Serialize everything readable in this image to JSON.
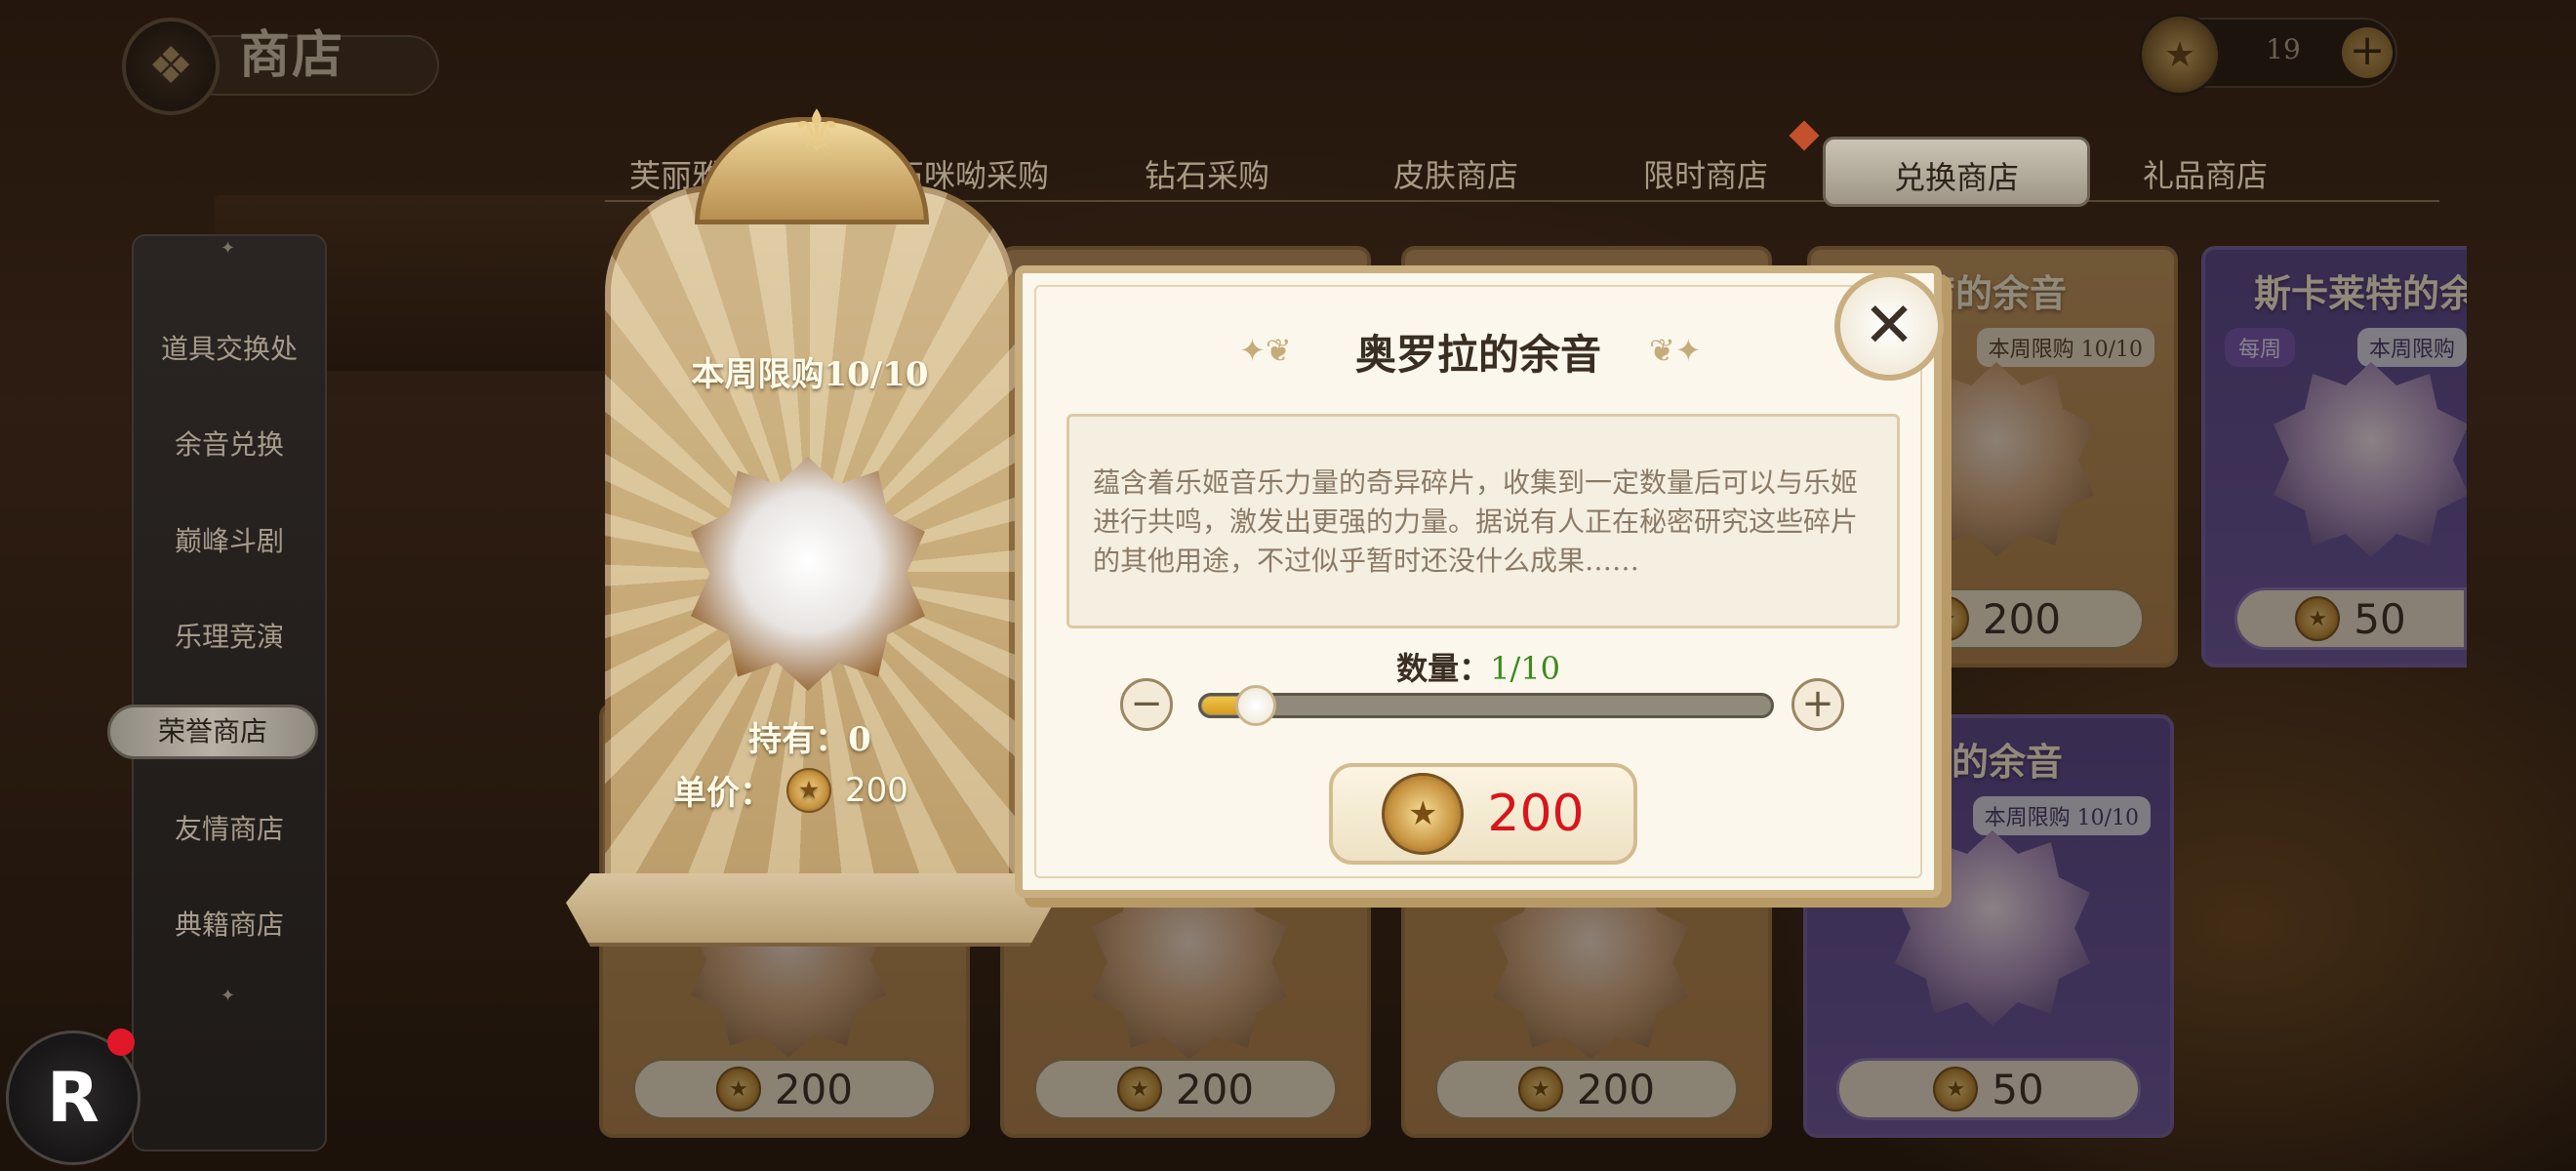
{
  "header": {
    "title": "商店",
    "back_icon": "back-ornament-icon",
    "currency_value": "19",
    "currency_plus": "+"
  },
  "tabs": [
    {
      "label": "芙丽雅"
    },
    {
      "label": "石咪呦采购"
    },
    {
      "label": "钻石采购"
    },
    {
      "label": "皮肤商店"
    },
    {
      "label": "限时商店"
    },
    {
      "label": "兑换商店",
      "active": true
    },
    {
      "label": "礼品商店"
    }
  ],
  "sidebar": {
    "items": [
      {
        "label": "道具交换处"
      },
      {
        "label": "余音兑换"
      },
      {
        "label": "巅峰斗剧"
      },
      {
        "label": "乐理竞演"
      },
      {
        "label": "荣誉商店",
        "active": true
      },
      {
        "label": "友情商店"
      },
      {
        "label": "典籍商店"
      }
    ]
  },
  "cards": [
    {
      "title": "茜的余音",
      "limit": "本周限购 10/10",
      "price": "200"
    },
    {
      "title": "斯卡莱特的余",
      "weekly": "每周",
      "limit": "本周限购",
      "price": "50"
    },
    {
      "price": "200"
    },
    {
      "price": "200"
    },
    {
      "price": "200"
    },
    {
      "title": "特的余音",
      "limit": "本周限购 10/10",
      "price": "50"
    }
  ],
  "preview": {
    "limit_text": "本周限购10/10",
    "hold_text": "持有：0",
    "unit_price_label": "单价：",
    "unit_price_value": "200"
  },
  "dialog": {
    "title": "奥罗拉的余音",
    "description": "蕴含着乐姬音乐力量的奇异碎片，收集到一定数量后可以与乐姬进行共鸣，激发出更强的力量。据说有人正在秘密研究这些碎片的其他用途，不过似乎暂时还没什么成果……",
    "quantity_label": "数量：",
    "quantity_value": "1/10",
    "quantity_fraction": 0.1,
    "minus": "−",
    "plus": "+",
    "close_icon": "close-icon",
    "buy_price": "200"
  },
  "logo": {
    "text": "R"
  },
  "colors": {
    "accent_gold": "#c9ae80",
    "price_red": "#d8151c",
    "qty_green": "#3d8a1e"
  }
}
